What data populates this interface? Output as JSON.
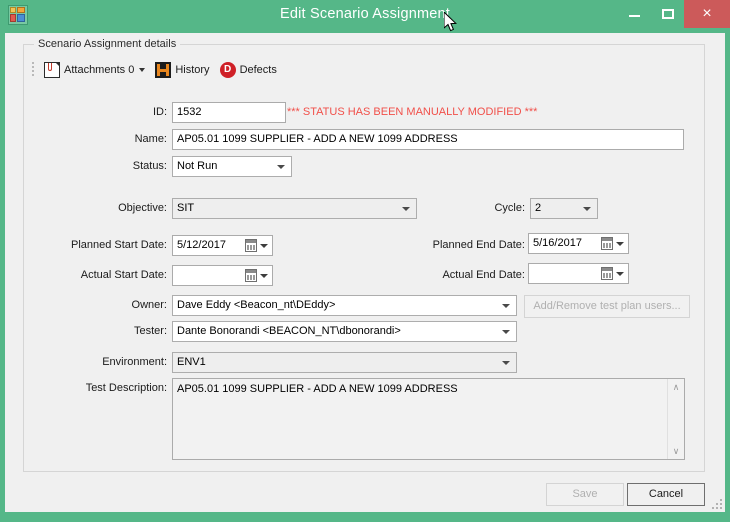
{
  "window": {
    "title": "Edit Scenario Assignment",
    "app_icon": "app-grid-icon",
    "minimize_label": "",
    "maximize_label": "",
    "close_label": "×",
    "titlebar_color": "#55b788",
    "close_color": "#cc5a5a"
  },
  "groupbox": {
    "legend": "Scenario Assignment details"
  },
  "toolbar": {
    "attachments_label": "Attachments 0",
    "history_label": "History",
    "defects_label": "Defects",
    "defects_glyph": "D",
    "history_glyph": "H"
  },
  "form": {
    "id_label": "ID:",
    "id_value": "1532",
    "status_warning": "*** STATUS HAS BEEN MANUALLY MODIFIED ***",
    "name_label": "Name:",
    "name_value": "AP05.01 1099 SUPPLIER - ADD A NEW 1099 ADDRESS",
    "status_label": "Status:",
    "status_value": "Not Run",
    "objective_label": "Objective:",
    "objective_value": "SIT",
    "cycle_label": "Cycle:",
    "cycle_value": "2",
    "planned_start_label": "Planned Start Date:",
    "planned_start_value": "5/12/2017",
    "planned_end_label": "Planned End Date:",
    "planned_end_value": "5/16/2017",
    "actual_start_label": "Actual Start Date:",
    "actual_start_value": "",
    "actual_end_label": "Actual End Date:",
    "actual_end_value": "",
    "owner_label": "Owner:",
    "owner_value": "Dave Eddy <Beacon_nt\\DEddy>",
    "tester_label": "Tester:",
    "tester_value": "Dante Bonorandi <BEACON_NT\\dbonorandi>",
    "add_remove_users_label": "Add/Remove test plan users...",
    "environment_label": "Environment:",
    "environment_value": "ENV1",
    "test_description_label": "Test Description:",
    "test_description_value": "AP05.01 1099 SUPPLIER - ADD A NEW 1099 ADDRESS",
    "warning_color": "#f1504a"
  },
  "footer": {
    "save_label": "Save",
    "cancel_label": "Cancel"
  },
  "scrollbar": {
    "up_glyph": "∧",
    "down_glyph": "∨"
  }
}
